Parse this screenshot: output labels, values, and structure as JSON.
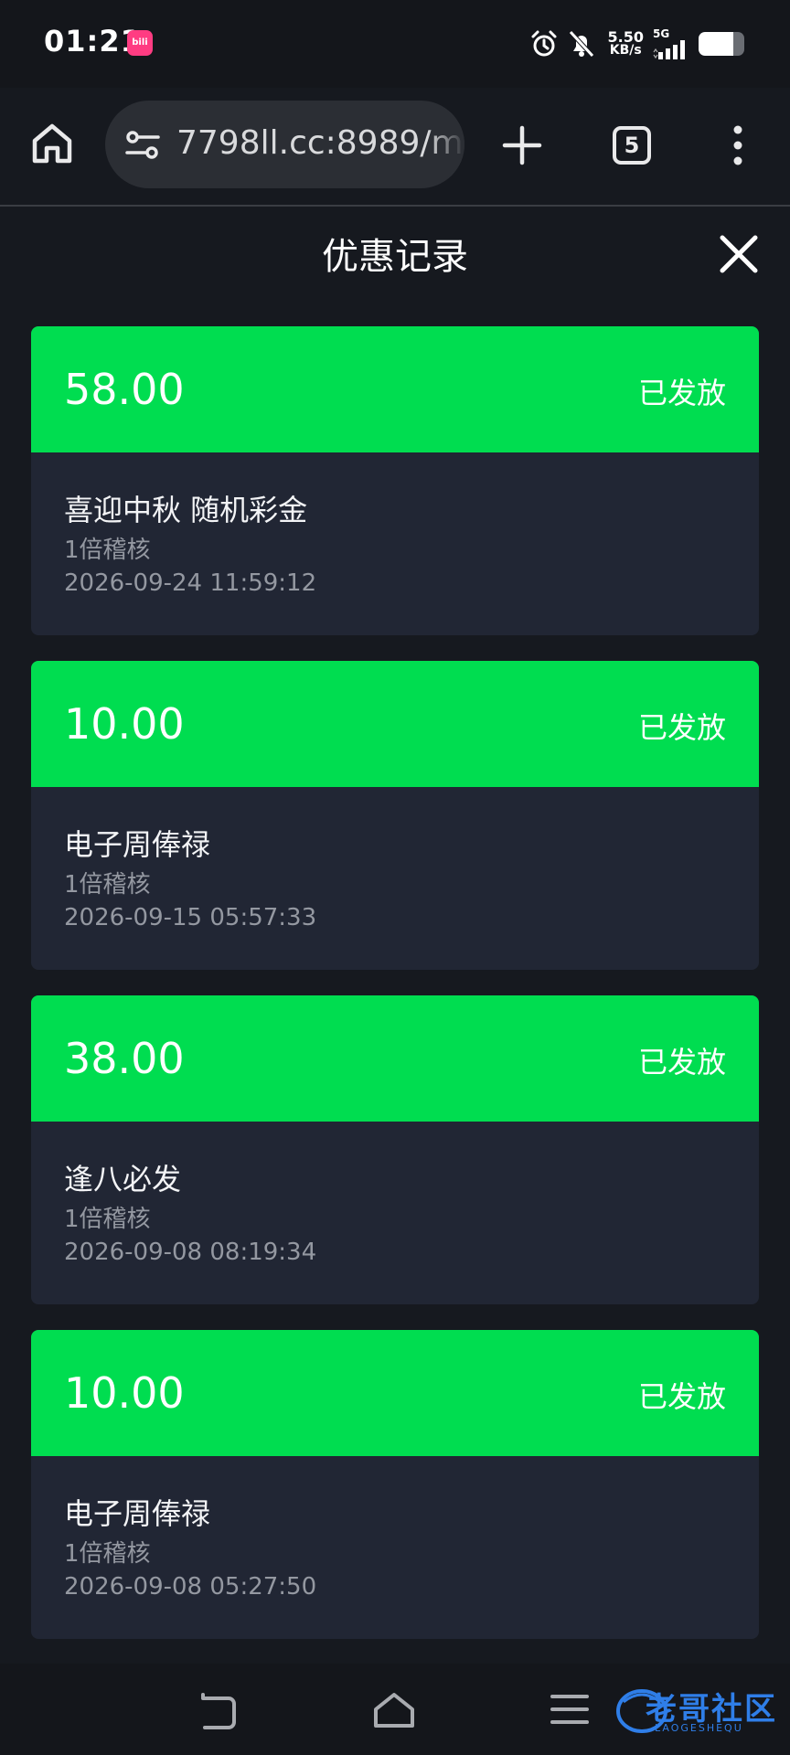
{
  "status_bar": {
    "time": "01:21",
    "app_badge": "bilibili",
    "speed_value": "5.50",
    "speed_unit": "KB/s",
    "network": "5G",
    "icons": [
      "alarm-icon",
      "mute-bell-icon",
      "signal-icon",
      "battery-icon"
    ],
    "battery_level": 0.75
  },
  "browser": {
    "url": "7798ll.cc:8989/m",
    "tab_count": "5",
    "icons": [
      "home-icon",
      "site-settings-icon",
      "plus-icon",
      "tabs-icon",
      "more-vert-icon"
    ]
  },
  "modal": {
    "title": "优惠记录",
    "close_icon": "close-icon"
  },
  "records": [
    {
      "amount": "58.00",
      "status": "已发放",
      "name": "喜迎中秋 随机彩金",
      "wager": "1倍稽核",
      "time": "2026-09-24 11:59:12"
    },
    {
      "amount": "10.00",
      "status": "已发放",
      "name": "电子周俸禄",
      "wager": "1倍稽核",
      "time": "2026-09-15 05:57:33"
    },
    {
      "amount": "38.00",
      "status": "已发放",
      "name": "逢八必发",
      "wager": "1倍稽核",
      "time": "2026-09-08 08:19:34"
    },
    {
      "amount": "10.00",
      "status": "已发放",
      "name": "电子周俸禄",
      "wager": "1倍稽核",
      "time": "2026-09-08 05:27:50"
    }
  ],
  "colors": {
    "background": "#16191f",
    "card_header": "#00dd50",
    "card_body": "#212634",
    "muted_text": "#9498a1"
  },
  "watermark": {
    "main": "老哥社区",
    "sub": "LAOGESHEQU"
  }
}
